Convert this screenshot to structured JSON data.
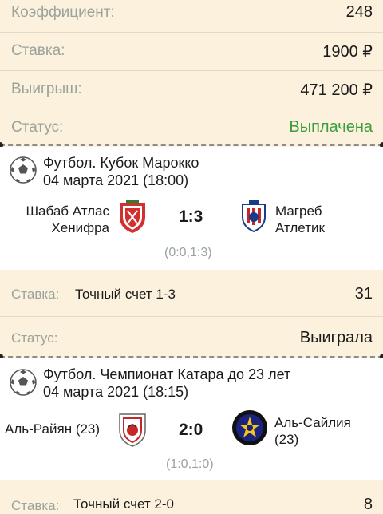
{
  "summary": {
    "coefficient_label": "Коэффициент:",
    "coefficient_value": "248",
    "stake_label": "Ставка:",
    "stake_value": "1900 ₽",
    "win_label": "Выигрыш:",
    "win_value": "471 200 ₽",
    "status_label": "Статус:",
    "status_value": "Выплачена"
  },
  "events": [
    {
      "title_line1": "Футбол. Кубок Марокко",
      "title_line2": "04 марта 2021 (18:00)",
      "home_line1": "Шабаб Атлас",
      "home_line2": "Хенифра",
      "score": "1:3",
      "away_line1": "Магреб",
      "away_line2": "Атлетик",
      "halftime": "(0:0,1:3)",
      "bet_label": "Ставка:",
      "bet_desc": "Точный счет 1-3",
      "bet_odds": "31",
      "status_label": "Статус:",
      "status_value": "Выиграла"
    },
    {
      "title_line1": "Футбол. Чемпионат Катара до 23 лет",
      "title_line2": "04 марта 2021 (18:15)",
      "home_line1": "Аль-Райян (23)",
      "score": "2:0",
      "away_line1": "Аль-Сайлия",
      "away_line2": "(23)",
      "halftime": "(1:0,1:0)",
      "bet_label": "Ставка:",
      "bet_desc": "Точный счет 2-0",
      "bet_odds": "8"
    }
  ],
  "colors": {
    "background": "#fbf1dd",
    "card": "#ffffff",
    "label": "#9aa39c",
    "status_green": "#3a9e3a"
  }
}
